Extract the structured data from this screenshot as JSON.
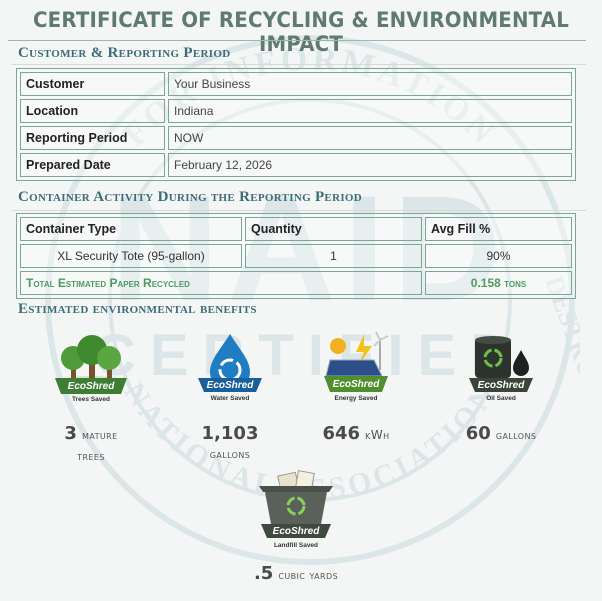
{
  "title": "CERTIFICATE OF RECYCLING & ENVIRONMENTAL IMPACT",
  "customer_section": {
    "heading": "Customer & Reporting Period",
    "rows": [
      {
        "label": "Customer",
        "value": "Your Business"
      },
      {
        "label": "Location",
        "value": "Indiana"
      },
      {
        "label": "Reporting Period",
        "value": "NOW"
      },
      {
        "label": "Prepared Date",
        "value": "February 12, 2026"
      }
    ]
  },
  "activity_section": {
    "heading": "Container Activity During the Reporting Period",
    "headers": [
      "Container Type",
      "Quantity",
      "Avg Fill %"
    ],
    "rows": [
      [
        "XL Security Tote (95-gallon)",
        "1",
        "90%"
      ]
    ],
    "total_label": "Total Estimated Paper Recycled",
    "total_value": "0.158",
    "total_unit": "tons"
  },
  "benefits_section": {
    "heading": "Estimated environmental benefits",
    "badge_brand": "EcoShred",
    "items": [
      {
        "badge_sub": "Trees Saved",
        "value": "3",
        "unit": "mature",
        "unit2": "trees",
        "icon": "trees-icon",
        "color": "#4a8a3c"
      },
      {
        "badge_sub": "Water Saved",
        "value": "1,103",
        "unit": "",
        "unit2": "gallons",
        "icon": "water-drop-icon",
        "color": "#1a6fb0"
      },
      {
        "badge_sub": "Energy Saved",
        "value": "646",
        "unit": "kWh",
        "unit2": "",
        "icon": "solar-energy-icon",
        "color": "#5d9a32"
      },
      {
        "badge_sub": "Oil Saved",
        "value": "60",
        "unit": "gallons",
        "unit2": "",
        "icon": "oil-barrel-icon",
        "color": "#3f4a3f"
      },
      {
        "badge_sub": "Landfill Saved",
        "value": ".5",
        "unit": "cubic yards",
        "unit2": "",
        "icon": "landfill-bin-icon",
        "color": "#4a5a4a"
      }
    ]
  },
  "watermark": {
    "text_top": "FOR INFORMATION",
    "text_bottom": "NATIONAL ASSOCIATION",
    "text_right": "DESTRUCTION",
    "letters": "NAID",
    "word": "CERTIFIED"
  }
}
